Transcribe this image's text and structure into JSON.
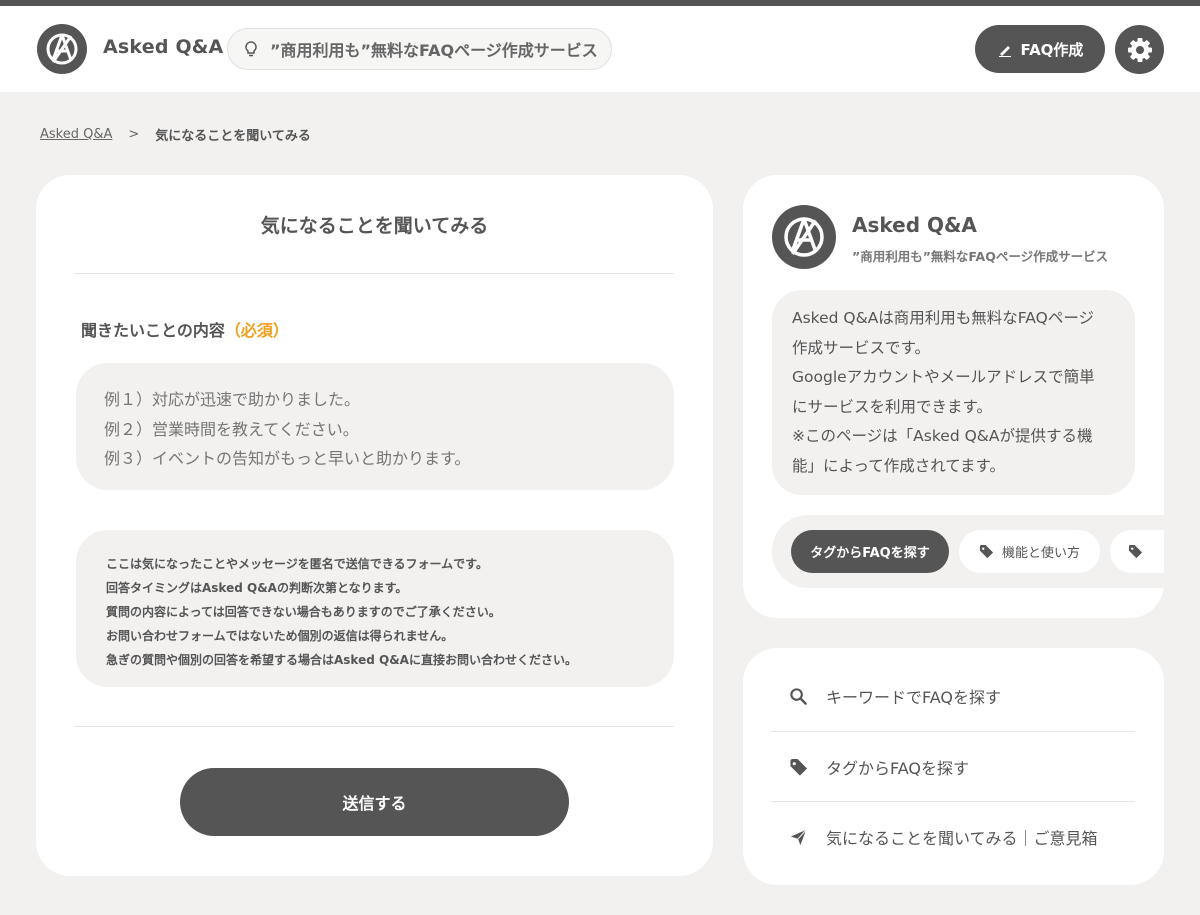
{
  "header": {
    "brand": "Asked Q&A",
    "tagline": "”商用利用も”無料なFAQページ作成サービス",
    "create_label": "FAQ作成"
  },
  "breadcrumb": {
    "home": "Asked Q&A",
    "separator": ">",
    "current": "気になることを聞いてみる"
  },
  "form": {
    "title": "気になることを聞いてみる",
    "field_label": "聞きたいことの内容",
    "required_label": "（必須）",
    "placeholder": "例１）対応が迅速で助かりました。\n例２）営業時間を教えてください。\n例３）イベントの告知がもっと早いと助かります。",
    "notice_lines": [
      "ここは気になったことやメッセージを匿名で送信できるフォームです。",
      "回答タイミングはAsked Q&Aの判断次第となります。",
      "質問の内容によっては回答できない場合もありますのでご了承ください。",
      "お問い合わせフォームではないため個別の返信は得られません。",
      "急ぎの質問や個別の回答を希望する場合はAsked Q&Aに直接お問い合わせください。"
    ],
    "submit_label": "送信する"
  },
  "profile": {
    "name": "Asked Q&A",
    "tagline": "”商用利用も”無料なFAQページ作成サービス",
    "description_lines": [
      "Asked Q&Aは商用利用も無料なFAQページ",
      "作成サービスです。",
      "Googleアカウントやメールアドレスで簡単",
      "にサービスを利用できます。",
      "※このページは「Asked Q&Aが提供する機",
      "能」によって作成されてます。"
    ],
    "tags": [
      {
        "label": "タグからFAQを探す",
        "icon": "none"
      },
      {
        "label": "機能と使い方",
        "icon": "tag-icon"
      },
      {
        "label": "",
        "icon": "tag-icon"
      }
    ]
  },
  "nav": {
    "items": [
      {
        "label": "キーワードでFAQを探す",
        "icon": "search-icon"
      },
      {
        "label": "タグからFAQを探す",
        "icon": "tag-icon"
      },
      {
        "label": "気になることを聞いてみる｜ご意見箱",
        "icon": "send-icon"
      }
    ]
  },
  "colors": {
    "primary": "#555555",
    "background": "#f2f1f0",
    "required": "#f0a020"
  }
}
